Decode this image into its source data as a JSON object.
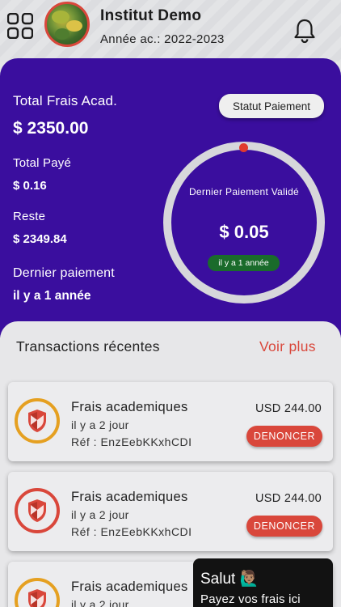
{
  "header": {
    "institution_name": "Institut Demo",
    "academic_year": "Année ac.: 2022-2023",
    "menu_icon": "grid-icon",
    "notification_icon": "bell-icon"
  },
  "summary": {
    "total_fees_label": "Total Frais Acad.",
    "total_fees_value": "$ 2350.00",
    "total_paid_label": "Total Payé",
    "total_paid_value": "$ 0.16",
    "remaining_label": "Reste",
    "remaining_value": "$ 2349.84",
    "last_payment_label": "Dernier paiement",
    "last_payment_value": "il y a 1 année",
    "status_button": "Statut Paiement",
    "ring_title": "Dernier Paiement Validé",
    "ring_amount": "$ 0.05",
    "ring_badge": "il y a 1 année"
  },
  "transactions": {
    "title": "Transactions récentes",
    "see_more": "Voir plus",
    "items": [
      {
        "name": "Frais academiques",
        "when": "il y a 2 jour",
        "ref": "Réf : EnzEebKKxhCDI",
        "amount": "USD 244.00",
        "action": "DENONCER",
        "status_color": "#e5a021"
      },
      {
        "name": "Frais academiques",
        "when": "il y a 2 jour",
        "ref": "Réf : EnzEebKKxhCDI",
        "amount": "USD 244.00",
        "action": "DENONCER",
        "status_color": "#d9473b"
      },
      {
        "name": "Frais academiques",
        "when": "il y a 2 jour",
        "ref": "",
        "amount": "",
        "action": "",
        "status_color": "#e5a021"
      }
    ]
  },
  "chat": {
    "greeting": "Salut 🙋🏽‍♂️",
    "message": "Payez vos frais ici"
  },
  "colors": {
    "primary_purple": "#3a0e9e",
    "accent_red": "#d9473b",
    "badge_green": "#1a6b2b",
    "pending_orange": "#e5a021"
  }
}
